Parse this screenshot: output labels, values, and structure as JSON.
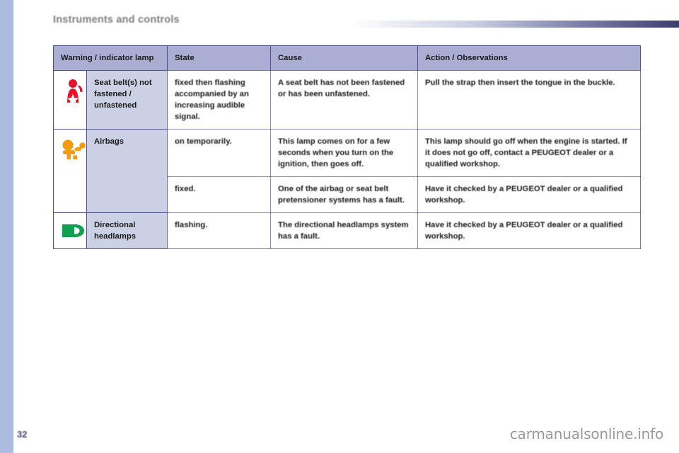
{
  "header": {
    "chapter_title": "Instruments and controls",
    "rule_gradient_from": "#ffffff",
    "rule_gradient_to": "#3c3f6b"
  },
  "colors": {
    "strip": "#aebbe0",
    "table_header_bg": "#a9aed2",
    "lamp_column_bg": "#ccd0e5",
    "border": "#4e4f85",
    "seatbelt_icon": "#e8122a",
    "airbag_icon": "#f59a12",
    "headlamp_icon": "#0fa050"
  },
  "table": {
    "columns": [
      {
        "key": "icon",
        "label": ""
      },
      {
        "key": "lamp",
        "label": "Warning / indicator lamp"
      },
      {
        "key": "state",
        "label": "State"
      },
      {
        "key": "cause",
        "label": "Cause"
      },
      {
        "key": "action",
        "label": "Action / Observations"
      }
    ],
    "rows": [
      {
        "icon": "seatbelt-warning-icon",
        "lamp": "Seat belt(s) not fastened / unfastened",
        "state": "fixed then flashing accompanied by an increasing audible signal.",
        "cause": "A seat belt has not been fastened or has been unfastened.",
        "action": "Pull the strap then insert the tongue in the buckle."
      },
      {
        "icon": "airbag-warning-icon",
        "lamp": "Airbags",
        "state": "on temporarily.",
        "cause": "This lamp comes on for a few seconds when you turn on the ignition, then goes off.",
        "action": "This lamp should go off when the engine is started. If it does not go off, contact a PEUGEOT dealer or a qualified workshop."
      },
      {
        "icon": "",
        "lamp": "",
        "state": "fixed.",
        "cause": "One of the airbag or seat belt pretensioner systems has a fault.",
        "action": "Have it checked by a PEUGEOT dealer or a qualified workshop."
      },
      {
        "icon": "directional-headlamp-icon",
        "lamp": "Directional headlamps",
        "state": "flashing.",
        "cause": "The directional headlamps system has a fault.",
        "action": "Have it checked by a PEUGEOT dealer or a qualified workshop."
      }
    ]
  },
  "footer": {
    "page_number": "32",
    "watermark": "carmanualsonline.info"
  }
}
